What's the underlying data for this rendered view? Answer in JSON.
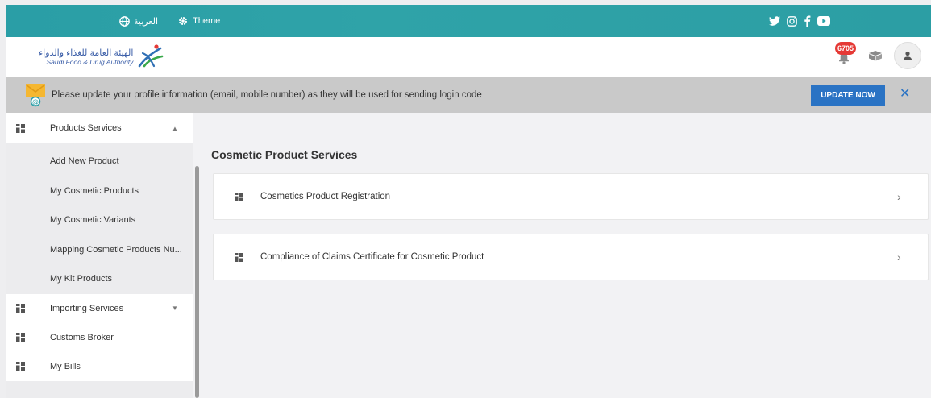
{
  "topbar": {
    "language_label": "العربية",
    "theme_label": "Theme",
    "icons": [
      "globe-icon",
      "gear-icon",
      "twitter-icon",
      "instagram-icon",
      "facebook-icon",
      "youtube-icon"
    ]
  },
  "header": {
    "logo_arabic": "الهيئة العامة للغذاء والدواء",
    "logo_english": "Saudi Food & Drug Authority",
    "notification_count": "6705"
  },
  "notice": {
    "message": "Please update your profile information (email, mobile number) as they will be used for sending login code",
    "button_label": "UPDATE NOW",
    "close_label": "✕"
  },
  "sidebar": {
    "products_services": "Products Services",
    "sub_items": [
      "Add New Product",
      "My Cosmetic Products",
      "My Cosmetic Variants",
      "Mapping Cosmetic Products Nu...",
      "My Kit Products"
    ],
    "importing_services": "Importing Services",
    "customs_broker": "Customs Broker",
    "my_bills": "My Bills"
  },
  "main": {
    "title": "Cosmetic Product Services",
    "cards": [
      "Cosmetics Product Registration",
      "Compliance of Claims Certificate for Cosmetic Product"
    ]
  },
  "colors": {
    "topbar": "#2fa3a8",
    "primary_button": "#2a73c4",
    "badge": "#e53935"
  }
}
